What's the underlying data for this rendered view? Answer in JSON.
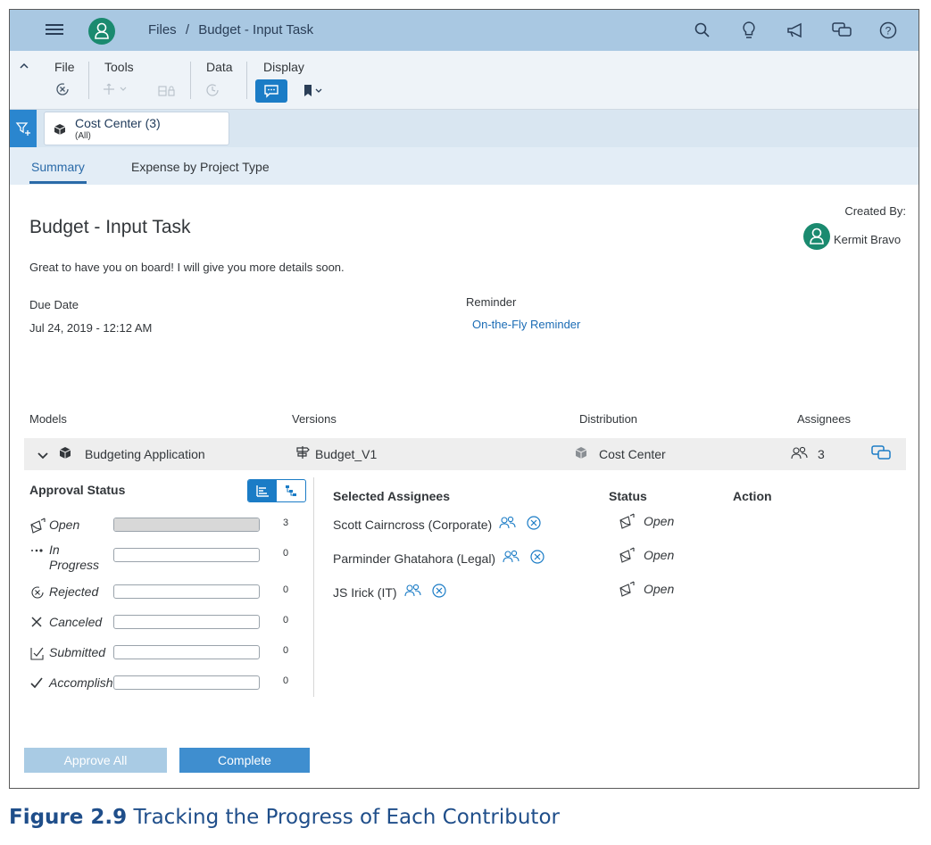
{
  "shell": {
    "breadcrumb_root": "Files",
    "breadcrumb_sep": "/",
    "breadcrumb_current": "Budget - Input Task"
  },
  "toolbar": {
    "groups": [
      "File",
      "Tools",
      "Data",
      "Display"
    ]
  },
  "filter": {
    "token_title": "Cost Center (3)",
    "token_sub": "(All)"
  },
  "tabs": [
    "Summary",
    "Expense by Project Type"
  ],
  "task": {
    "title": "Budget - Input Task",
    "description": "Great to have you on board! I will give you more details soon.",
    "created_by_label": "Created By:",
    "created_by_name": "Kermit Bravo",
    "due_date_label": "Due Date",
    "due_date": "Jul 24, 2019 - 12:12 AM",
    "reminder_label": "Reminder",
    "reminder_value": "On-the-Fly Reminder"
  },
  "models_table": {
    "headers": [
      "Models",
      "Versions",
      "Distribution",
      "Assignees"
    ],
    "row": {
      "model": "Budgeting Application",
      "version": "Budget_V1",
      "distribution": "Cost Center",
      "assignees": "3"
    }
  },
  "approval": {
    "title": "Approval Status",
    "statuses": [
      {
        "label": "Open",
        "count": "3",
        "fill": 1.0,
        "icon": "open-envelope-icon"
      },
      {
        "label": "In Progress",
        "count": "0",
        "fill": 0,
        "icon": "dots-icon"
      },
      {
        "label": "Rejected",
        "count": "0",
        "fill": 0,
        "icon": "rejected-icon"
      },
      {
        "label": "Canceled",
        "count": "0",
        "fill": 0,
        "icon": "cancel-x-icon"
      },
      {
        "label": "Submitted",
        "count": "0",
        "fill": 0,
        "icon": "submitted-icon"
      },
      {
        "label": "Accomplish",
        "count": "0",
        "fill": 0,
        "icon": "checkmark-icon"
      }
    ]
  },
  "assignees": {
    "headers": [
      "Selected Assignees",
      "Status",
      "Action"
    ],
    "rows": [
      {
        "name": "Scott Cairncross (Corporate)",
        "status": "Open"
      },
      {
        "name": "Parminder Ghatahora (Legal)",
        "status": "Open"
      },
      {
        "name": "JS Irick (IT)",
        "status": "Open"
      }
    ]
  },
  "buttons": {
    "approve_all": "Approve All",
    "complete": "Complete"
  },
  "caption": {
    "figure": "Figure 2.9",
    "text": "Tracking the Progress of Each Contributor"
  },
  "colors": {
    "shell": "#a9c8e2",
    "accent": "#1b7cc6",
    "avatar": "#1a8a6f"
  }
}
